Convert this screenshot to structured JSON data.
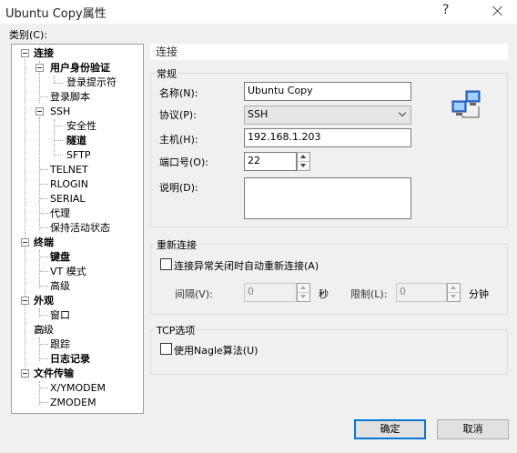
{
  "window": {
    "title": "Ubuntu Copy属性",
    "help": "?"
  },
  "category_label": "类别(C):",
  "tree": [
    {
      "label": "连接",
      "bold": true
    },
    {
      "label": "用户身份验证",
      "bold": true
    },
    {
      "label": "登录提示符",
      "bold": false
    },
    {
      "label": "登录脚本",
      "bold": false
    },
    {
      "label": "SSH",
      "bold": false
    },
    {
      "label": "安全性",
      "bold": false
    },
    {
      "label": "隧道",
      "bold": true
    },
    {
      "label": "SFTP",
      "bold": false
    },
    {
      "label": "TELNET",
      "bold": false
    },
    {
      "label": "RLOGIN",
      "bold": false
    },
    {
      "label": "SERIAL",
      "bold": false
    },
    {
      "label": "代理",
      "bold": false
    },
    {
      "label": "保持活动状态",
      "bold": false
    },
    {
      "label": "终端",
      "bold": true
    },
    {
      "label": "键盘",
      "bold": true
    },
    {
      "label": "VT 模式",
      "bold": false
    },
    {
      "label": "高级",
      "bold": false
    },
    {
      "label": "外观",
      "bold": true
    },
    {
      "label": "窗口",
      "bold": false
    },
    {
      "label": "高级",
      "bold": false
    },
    {
      "label": "跟踪",
      "bold": false
    },
    {
      "label": "日志记录",
      "bold": true
    },
    {
      "label": "文件传输",
      "bold": true
    },
    {
      "label": "X/YMODEM",
      "bold": false
    },
    {
      "label": "ZMODEM",
      "bold": false
    }
  ],
  "section_title": "连接",
  "general": {
    "group_label": "常规",
    "name_label": "名称(N):",
    "name_value": "Ubuntu Copy",
    "protocol_label": "协议(P):",
    "protocol_value": "SSH",
    "host_label": "主机(H):",
    "host_value": "192.168.1.203",
    "port_label": "端口号(O):",
    "port_value": "22",
    "desc_label": "说明(D):",
    "desc_value": ""
  },
  "reconnect": {
    "group_label": "重新连接",
    "checkbox_label": "连接异常关闭时自动重新连接(A)",
    "interval_label": "间隔(V):",
    "interval_value": "0",
    "interval_unit": "秒",
    "limit_label": "限制(L):",
    "limit_value": "0",
    "limit_unit": "分钟"
  },
  "tcp": {
    "group_label": "TCP选项",
    "nagle_label": "使用Nagle算法(U)"
  },
  "buttons": {
    "ok": "确定",
    "cancel": "取消"
  },
  "icons": {
    "network": "network-computers-icon"
  }
}
